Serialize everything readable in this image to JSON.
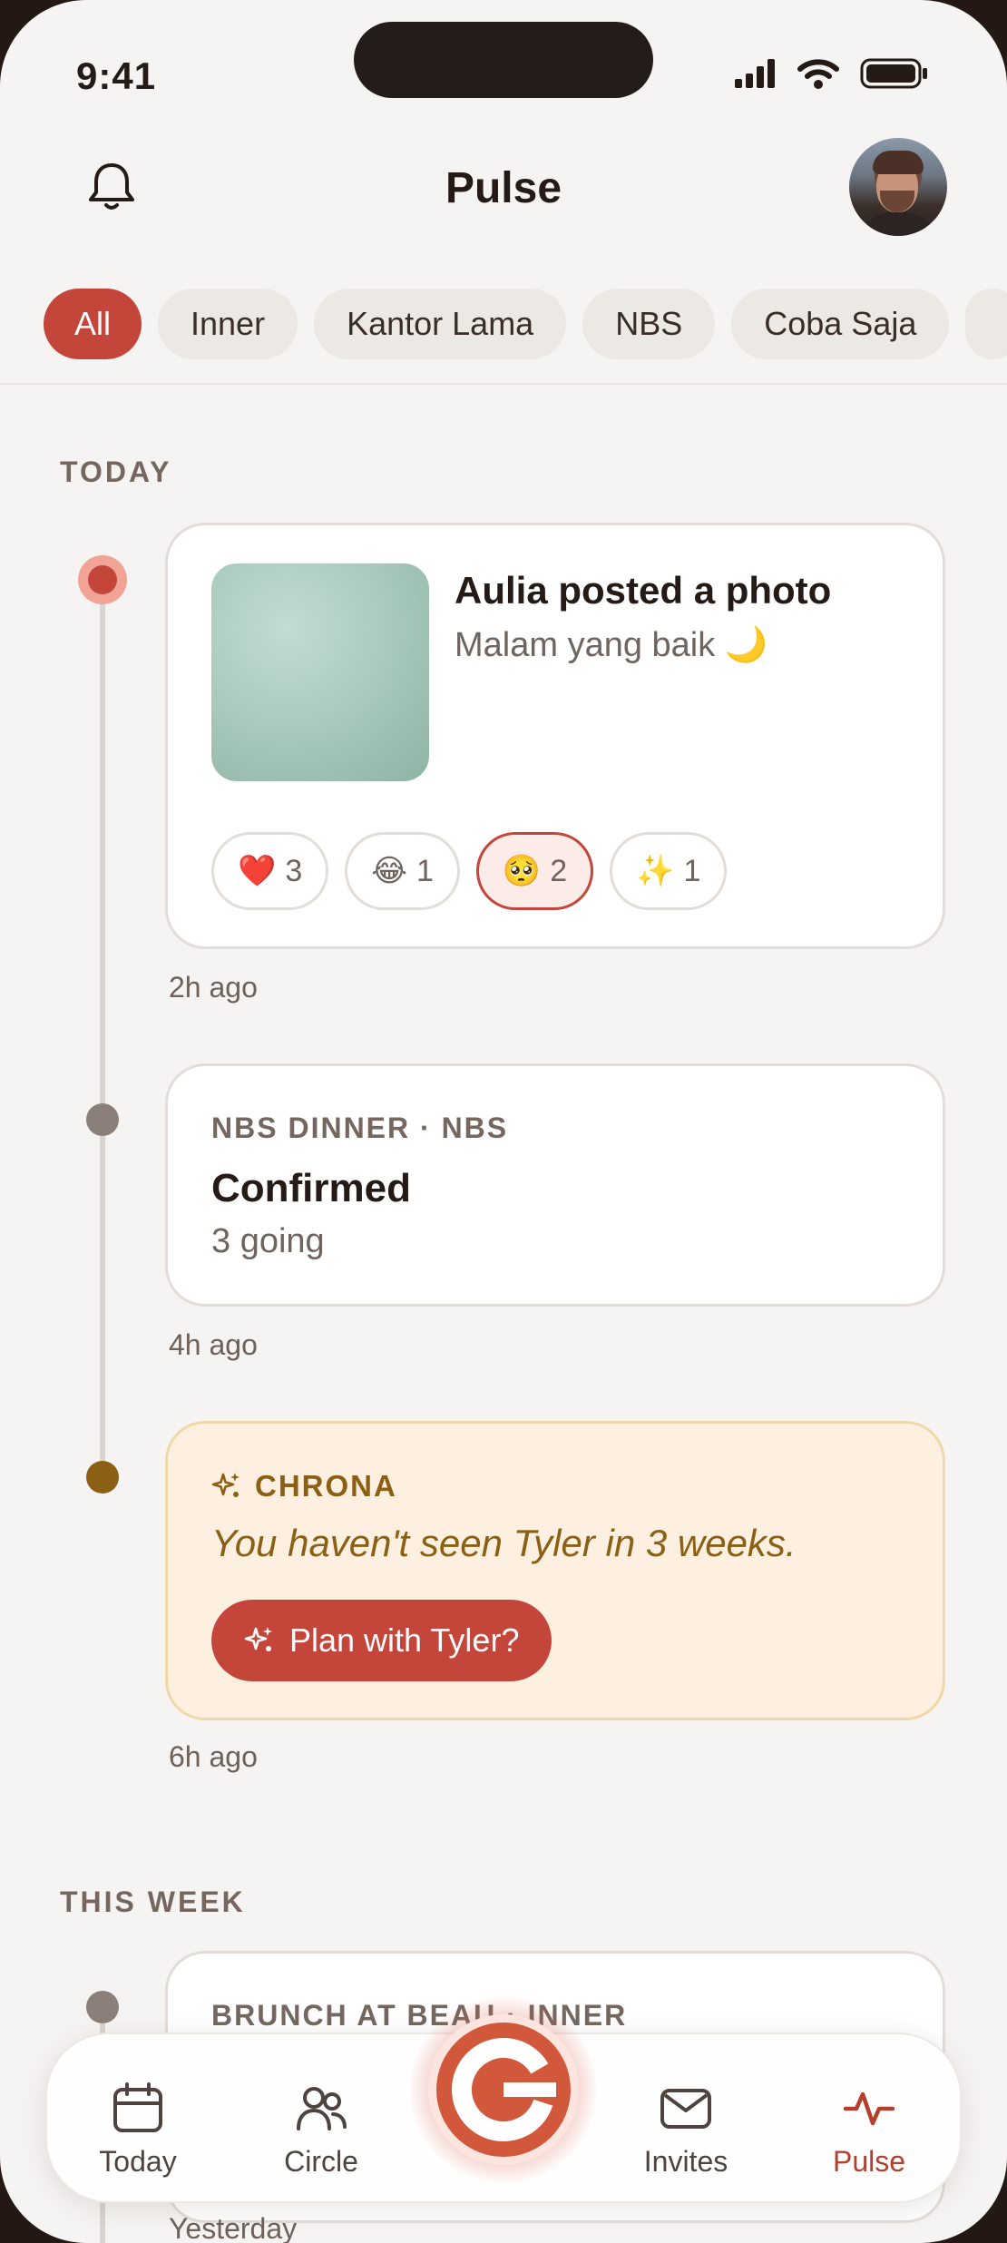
{
  "status_bar": {
    "time": "9:41"
  },
  "header": {
    "title": "Pulse"
  },
  "filters": [
    "All",
    "Inner",
    "Kantor Lama",
    "NBS",
    "Coba Saja"
  ],
  "sections": {
    "today": "TODAY",
    "this_week": "THIS WEEK"
  },
  "photo_post": {
    "title": "Aulia posted a photo",
    "caption": "Malam yang baik 🌙",
    "time": "2h ago",
    "reactions": [
      {
        "emoji": "❤️",
        "count": "3"
      },
      {
        "emoji": "😂",
        "count": "1"
      },
      {
        "emoji": "🥺",
        "count": "2"
      },
      {
        "emoji": "✨",
        "count": "1"
      }
    ]
  },
  "event": {
    "kicker": "NBS DINNER · NBS",
    "title": "Confirmed",
    "subtitle": "3 going",
    "time": "4h ago"
  },
  "chrona": {
    "kicker": "CHRONA",
    "message": "You haven't seen Tyler in 3 weeks.",
    "button": "Plan with Tyler?",
    "time": "6h ago"
  },
  "week_event": {
    "kicker": "BRUNCH AT BEAU · INNER",
    "time": "Yesterday"
  },
  "nav": {
    "today": "Today",
    "circle": "Circle",
    "invites": "Invites",
    "pulse": "Pulse"
  },
  "colors": {
    "accent": "#c4463a",
    "chrona": "#8b5f14",
    "background": "#f6f4f2"
  }
}
